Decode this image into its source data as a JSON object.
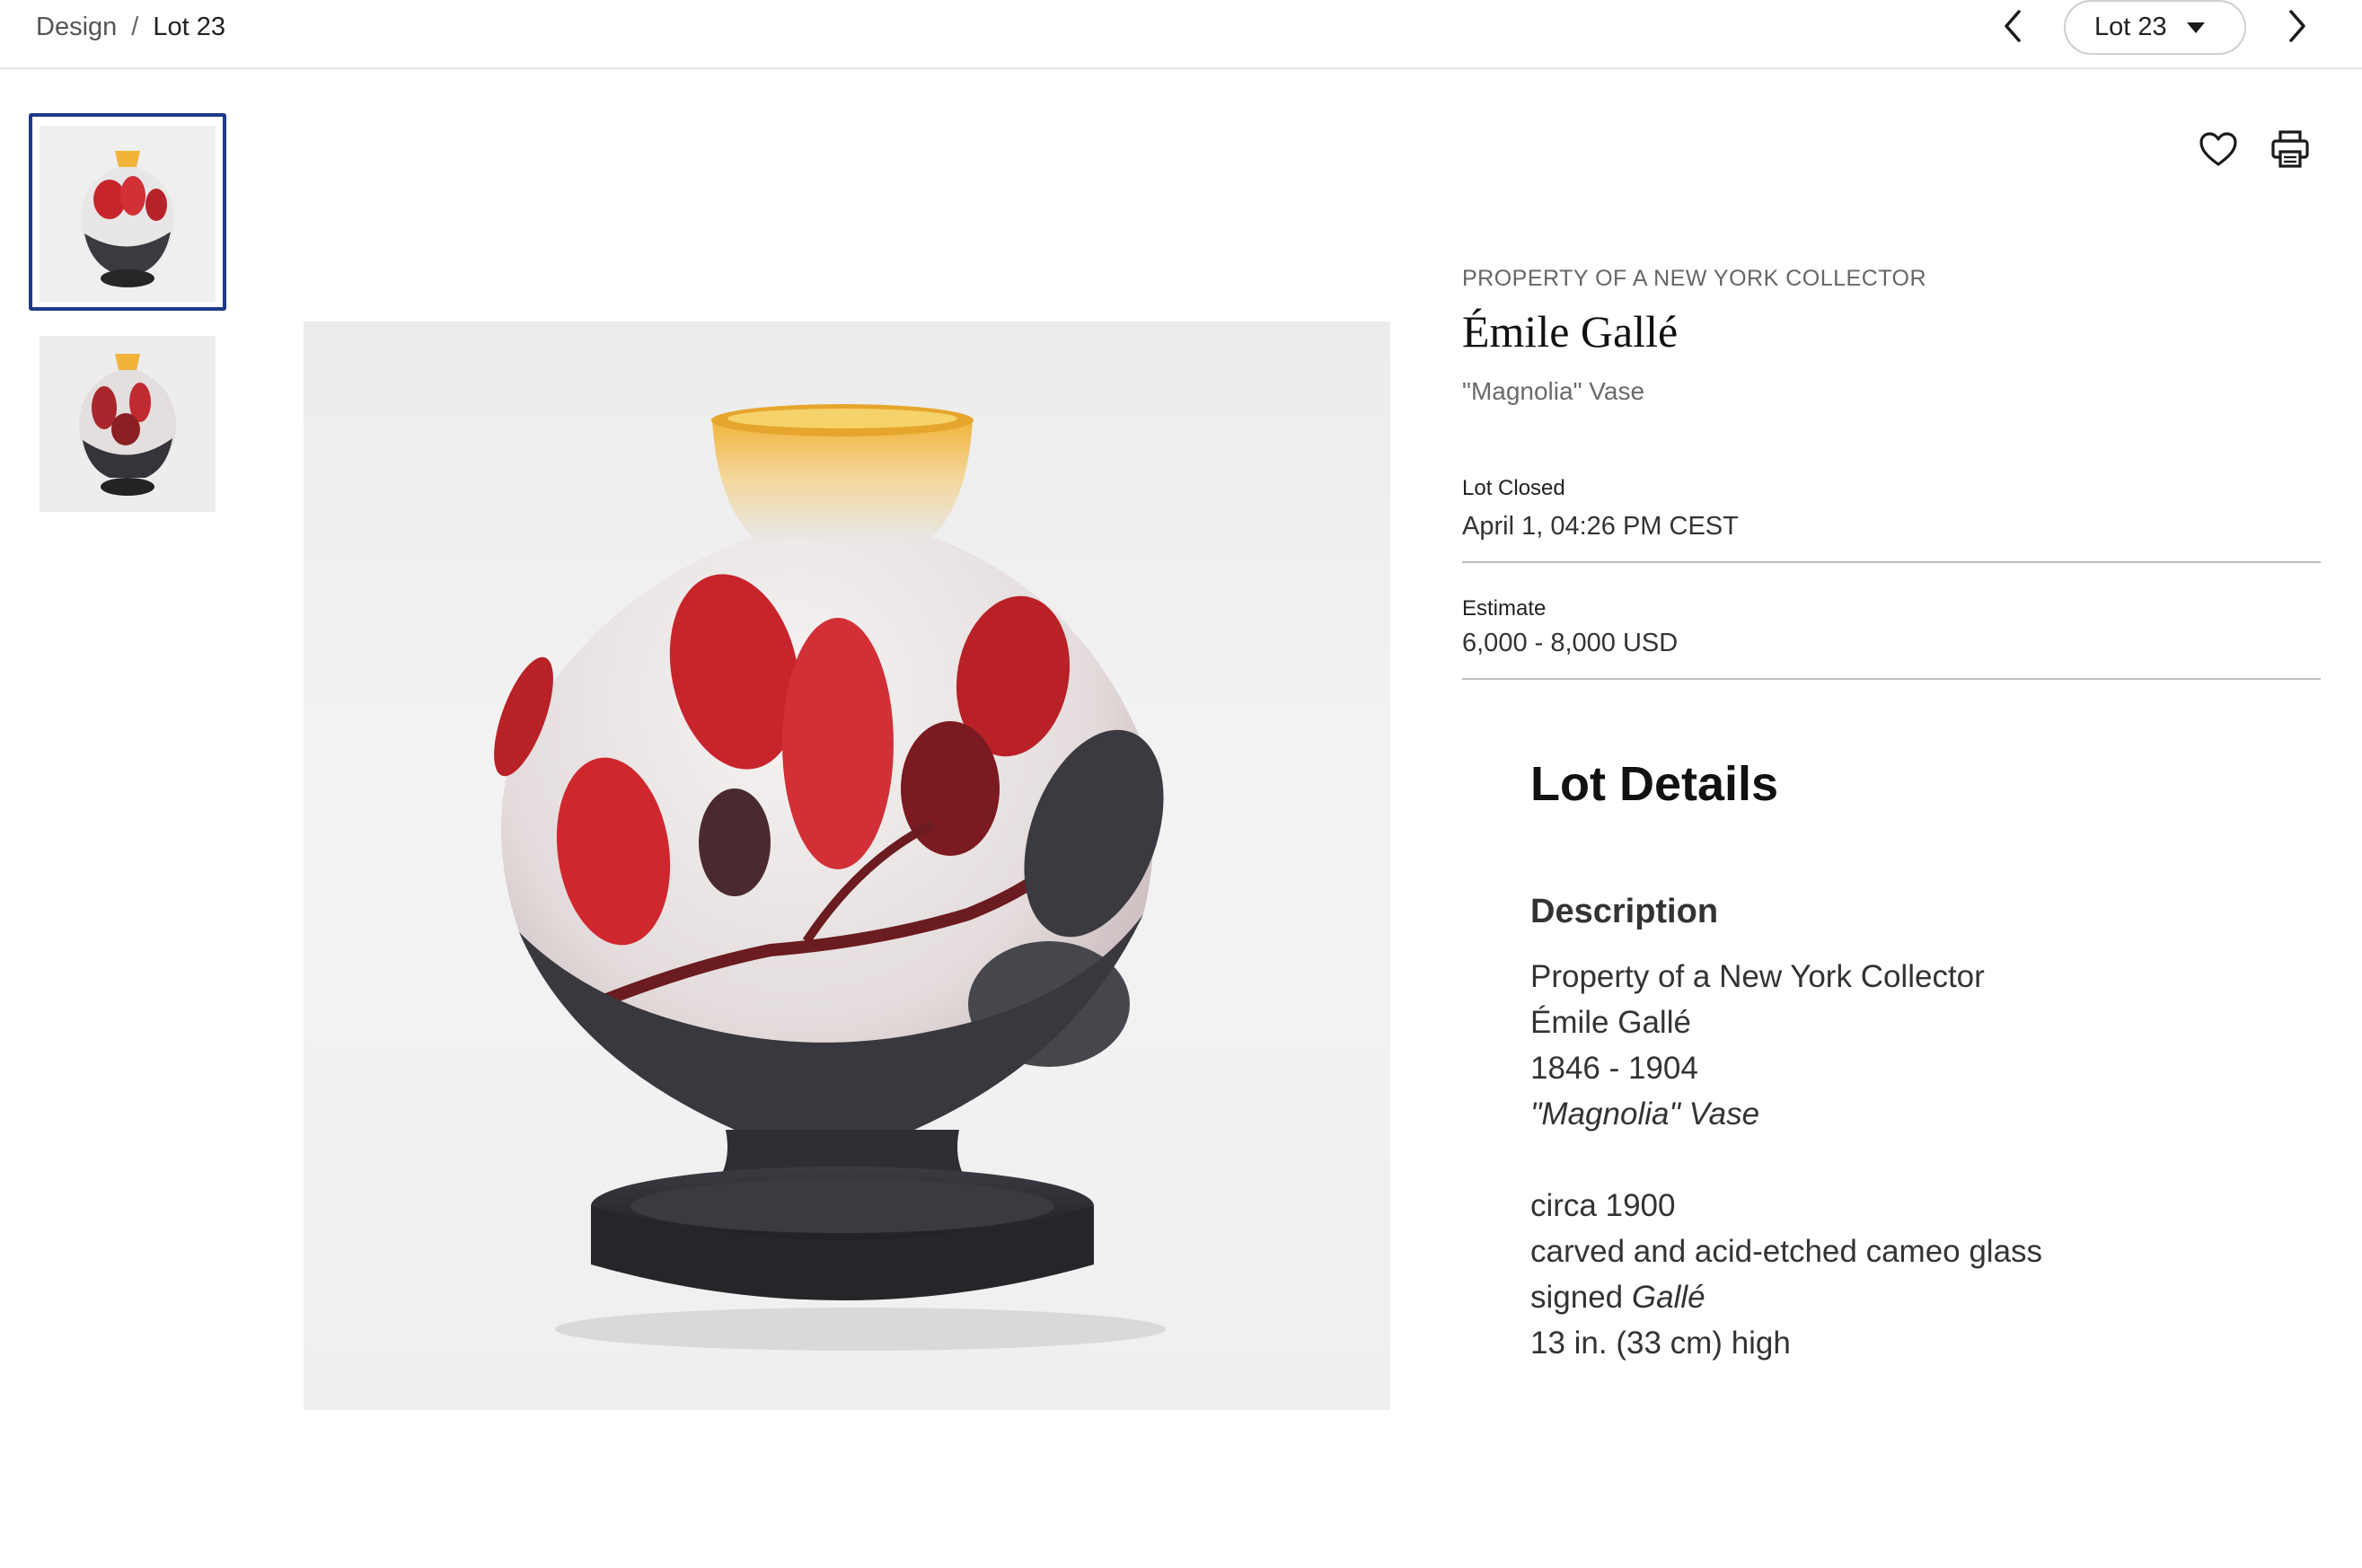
{
  "breadcrumb": {
    "parent": "Design",
    "separator": "/",
    "current": "Lot 23"
  },
  "lot_nav": {
    "prev_icon": "chevron-left-icon",
    "next_icon": "chevron-right-icon",
    "selected_lot": "Lot 23",
    "dropdown_icon": "caret-down-icon"
  },
  "actions": {
    "favorite_icon": "heart-icon",
    "print_icon": "printer-icon"
  },
  "lot": {
    "provenance": "PROPERTY OF A NEW YORK COLLECTOR",
    "artist": "Émile Gallé",
    "title": "\"Magnolia\" Vase",
    "status_label": "Lot Closed",
    "status_value": "April 1, 04:26 PM CEST",
    "estimate_label": "Estimate",
    "estimate_value": "6,000 - 8,000 USD"
  },
  "details": {
    "heading": "Lot Details",
    "description_heading": "Description",
    "line1": "Property of a New York Collector",
    "line2": "Émile Gallé",
    "line3": "1846 - 1904",
    "line4": "\"Magnolia\" Vase",
    "line5": "circa 1900",
    "line6": "carved and acid-etched cameo glass",
    "line7_prefix": "signed ",
    "line7_signature": "Gallé",
    "line8": "13 in. (33 cm) high"
  },
  "colors": {
    "selected_border": "#1e3a8a",
    "vase_red": "#c8242b",
    "vase_dark": "#2f2f35",
    "vase_neck": "#f0b43a"
  }
}
